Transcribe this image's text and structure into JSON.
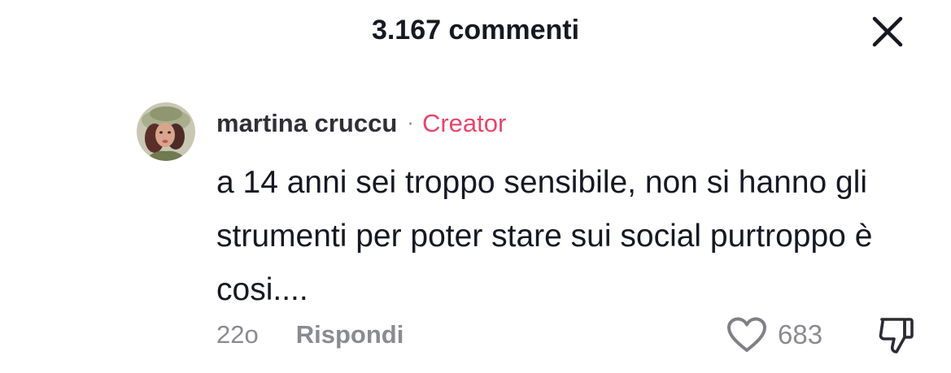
{
  "header": {
    "title": "3.167 commenti",
    "close_icon": "close-icon"
  },
  "comment": {
    "avatar_icon": "user-avatar",
    "username": "martina cruccu",
    "separator": "·",
    "badge": "Creator",
    "text": "a 14 anni sei troppo sensibile, non si hanno gli strumenti per poter stare sui social purtroppo è cosi....",
    "timestamp": "22o",
    "reply_label": "Rispondi",
    "like_icon": "heart-outline-icon",
    "like_count": "683",
    "dislike_icon": "thumbs-down-icon"
  },
  "colors": {
    "text": "#161823",
    "secondary": "#8a8b91",
    "badge": "#e8466a"
  }
}
